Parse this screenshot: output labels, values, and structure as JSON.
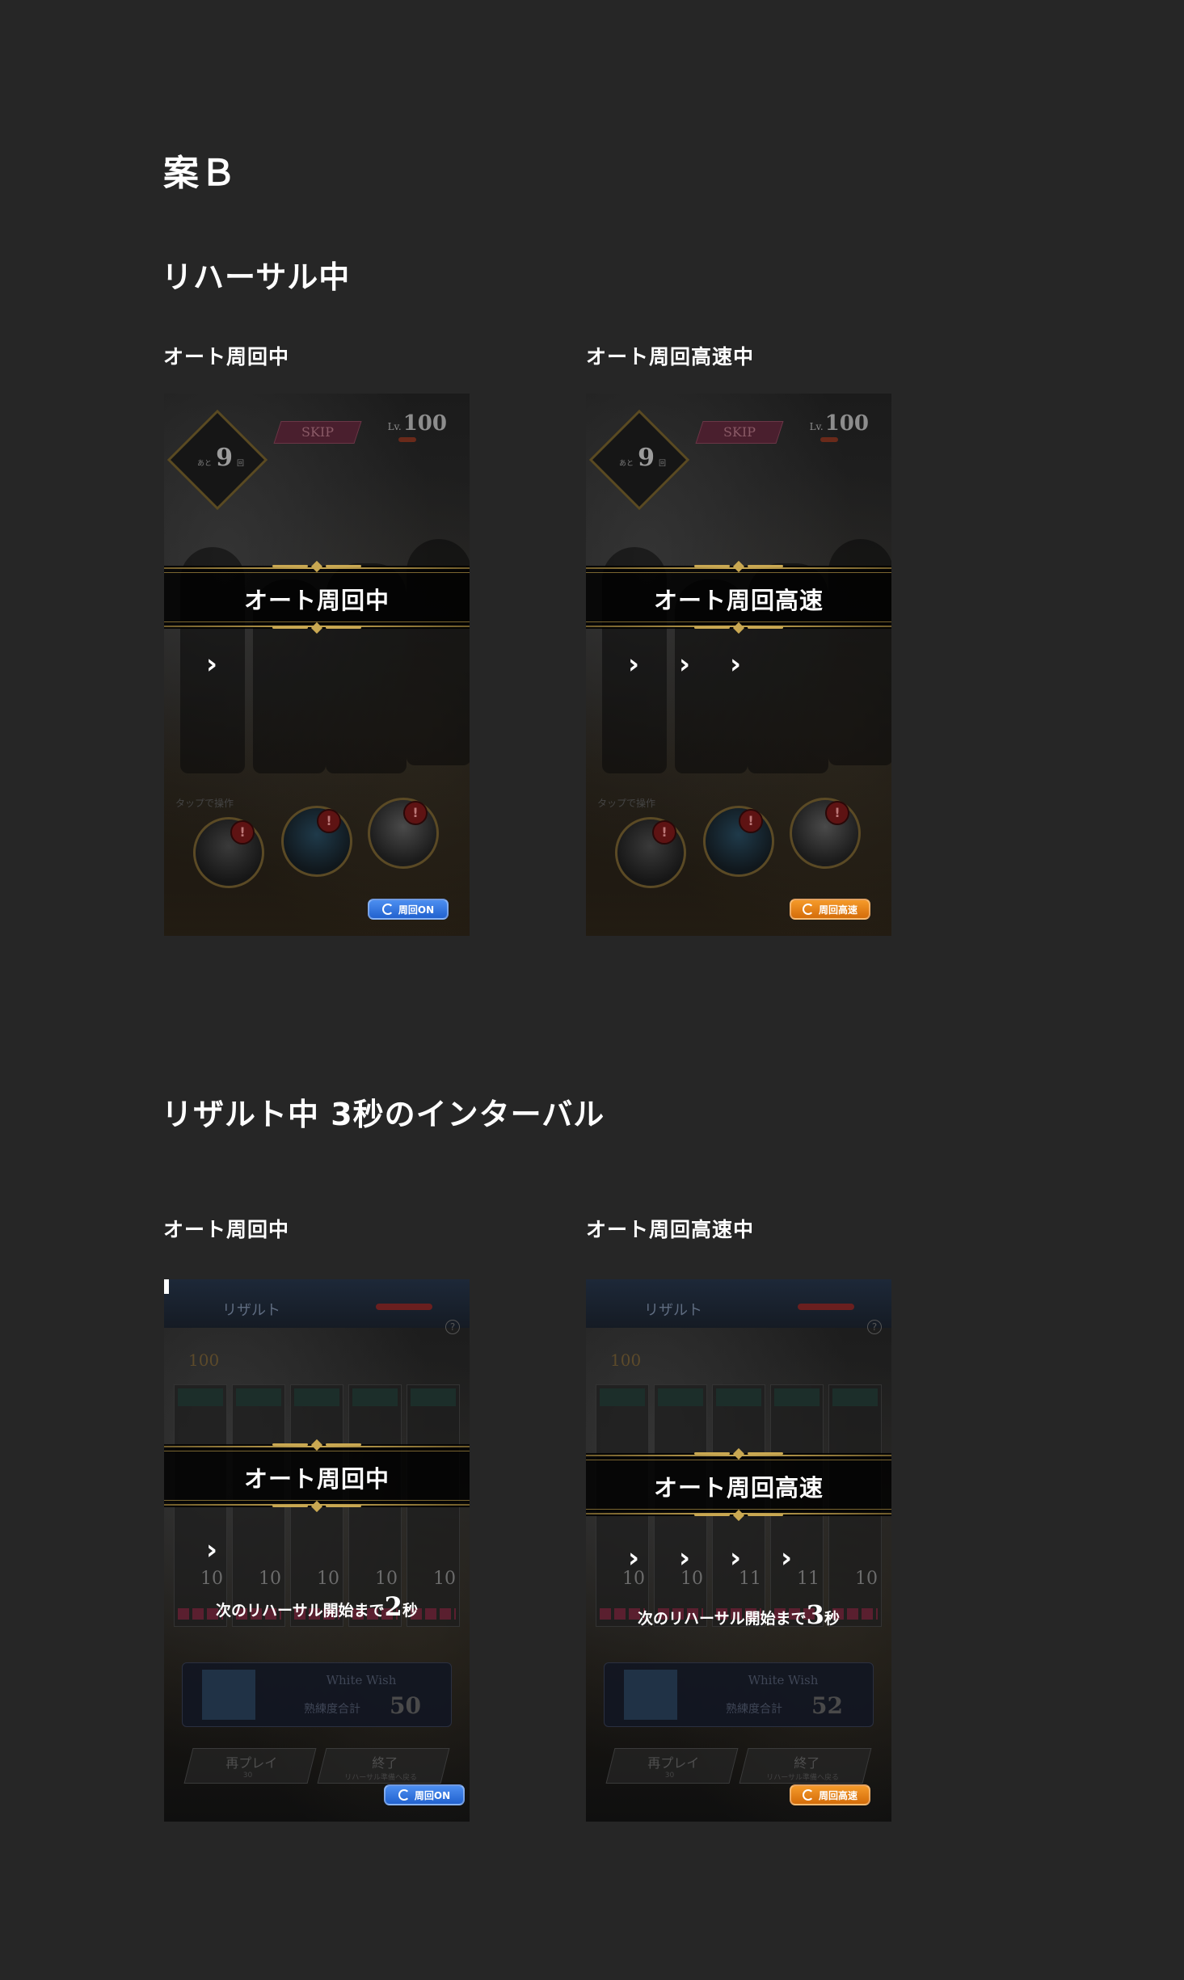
{
  "heading": "案Ｂ",
  "sections": {
    "rehearsal": {
      "title": "リハーサル中",
      "left_label": "オート周回中",
      "right_label": "オート周回高速中"
    },
    "result": {
      "title": "リザルト中 3秒のインターバル",
      "left_label": "オート周回中",
      "right_label": "オート周回高速中"
    }
  },
  "screens": {
    "rehearsal_normal": {
      "banner": "オート周回中",
      "chevron": "›",
      "toggle": "周回ON",
      "skip": "SKIP",
      "lv_prefix": "Lv.",
      "lv_value": "100",
      "badge_prefix": "あと",
      "badge_num": "9",
      "badge_suffix": "回",
      "tap_hint": "タップで操作"
    },
    "rehearsal_fast": {
      "banner": "オート周回高速",
      "chevrons": [
        "›",
        "›",
        "›"
      ],
      "toggle": "周回高速",
      "skip": "SKIP",
      "lv_prefix": "Lv.",
      "lv_value": "100",
      "badge_prefix": "あと",
      "badge_num": "9",
      "badge_suffix": "回",
      "tap_hint": "タップで操作"
    },
    "result_normal": {
      "banner": "オート周回中",
      "chevron": "›",
      "countdown_prefix": "次のリハーサル開始まで",
      "countdown_num": "2",
      "countdown_suffix": "秒",
      "toggle": "周回ON",
      "header": "リザルト",
      "header_lv": "100",
      "card_values": [
        "10",
        "10",
        "10",
        "10",
        "10"
      ],
      "song_name": "White Wish",
      "song_label": "熟練度合計",
      "song_value": "50",
      "replay": "再プレイ",
      "replay_cost": "30",
      "finish": "終了",
      "finish_sub": "リハーサル準備へ戻る"
    },
    "result_fast": {
      "banner": "オート周回高速",
      "chevrons": [
        "›",
        "›",
        "›",
        "›"
      ],
      "countdown_prefix": "次のリハーサル開始まで",
      "countdown_num": "3",
      "countdown_suffix": "秒",
      "toggle": "周回高速",
      "header": "リザルト",
      "header_lv": "100",
      "card_values": [
        "10",
        "10",
        "11",
        "11",
        "10"
      ],
      "song_name": "White Wish",
      "song_label": "熟練度合計",
      "song_value": "52",
      "replay": "再プレイ",
      "replay_cost": "30",
      "finish": "終了",
      "finish_sub": "リハーサル準備へ戻る"
    }
  },
  "colors": {
    "page_bg": "#262626",
    "gold": "#c9a852",
    "toggle_on_blue": "#2f75e0",
    "toggle_fast_orange": "#e67f16"
  }
}
